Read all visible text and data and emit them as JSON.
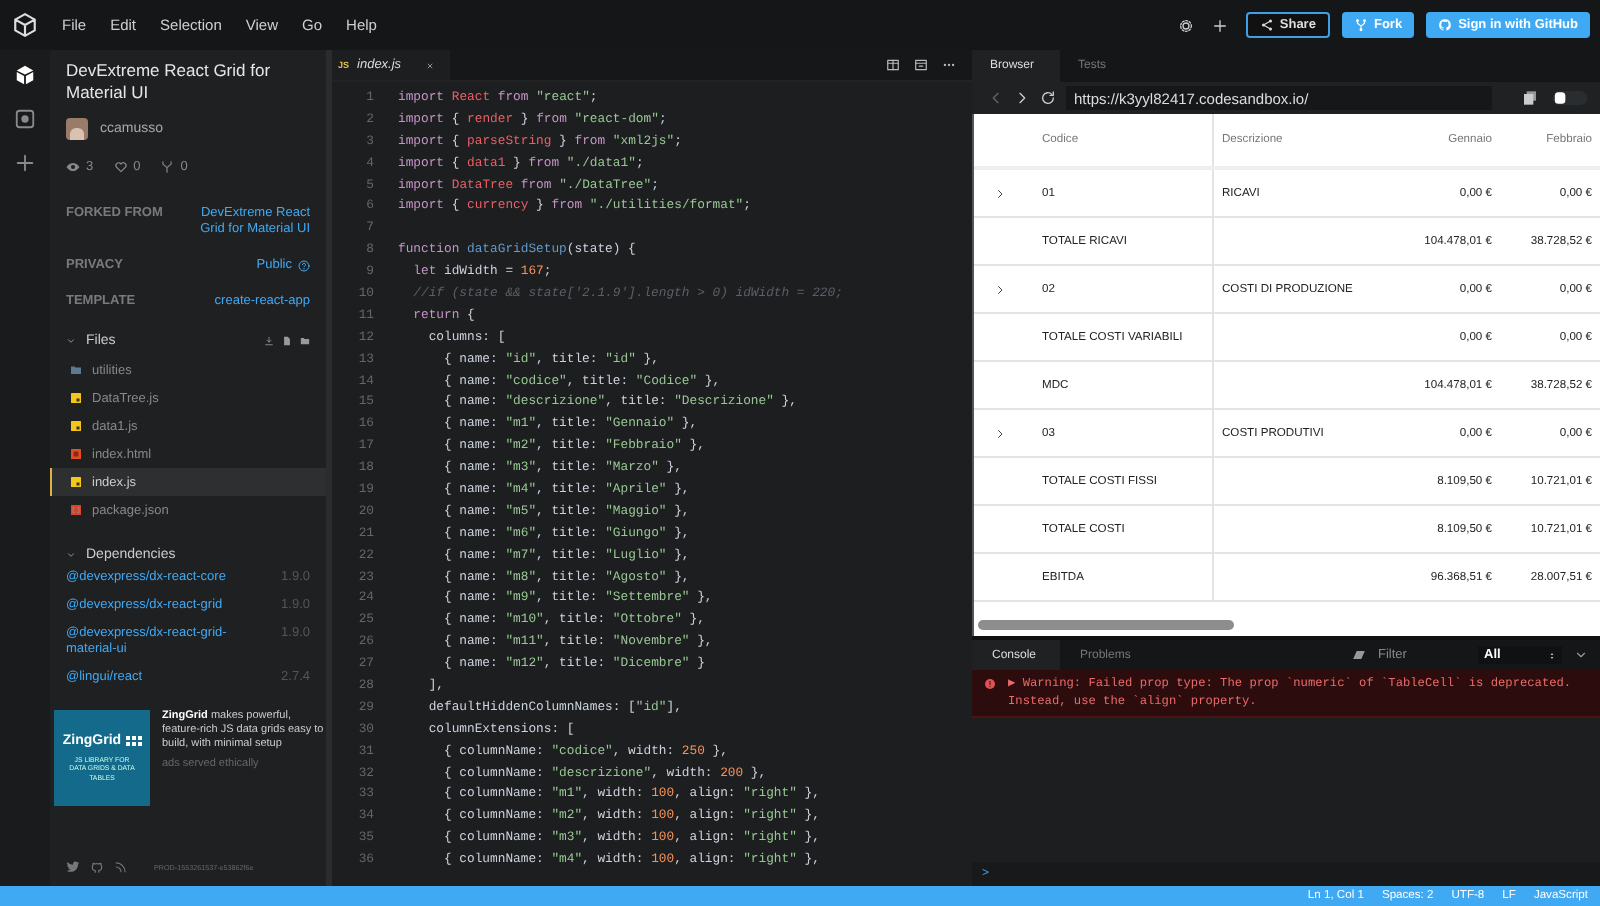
{
  "menu": [
    "File",
    "Edit",
    "Selection",
    "View",
    "Go",
    "Help"
  ],
  "header_actions": [
    {
      "kind": "settings"
    },
    {
      "kind": "add"
    }
  ],
  "header_buttons": [
    {
      "kind": "share",
      "label": "Share"
    },
    {
      "kind": "fork",
      "label": "Fork"
    },
    {
      "kind": "github",
      "label": "Sign in with GitHub"
    }
  ],
  "activity_bar": [
    {
      "kind": "sandbox",
      "selected": true
    },
    {
      "kind": "deploy",
      "selected": false
    },
    {
      "kind": "add",
      "selected": false
    }
  ],
  "sidebar": {
    "title": "DevExtreme React Grid for Material UI",
    "author": "ccamusso",
    "stats": [
      {
        "kind": "views",
        "value": "3"
      },
      {
        "kind": "likes",
        "value": "0"
      },
      {
        "kind": "forks",
        "value": "0"
      }
    ],
    "info": [
      {
        "label": "FORKED FROM",
        "value": "DevExtreme React Grid for Material UI",
        "kind": "link"
      },
      {
        "label": "PRIVACY",
        "value": "Public",
        "kind": "help"
      },
      {
        "label": "TEMPLATE",
        "value": "create-react-app",
        "kind": "link"
      }
    ],
    "files": {
      "title": "Files",
      "expanded": true,
      "items": [
        {
          "name": "utilities",
          "kind": "folder",
          "selected": false
        },
        {
          "name": "DataTree.js",
          "kind": "js",
          "selected": false
        },
        {
          "name": "data1.js",
          "kind": "js",
          "selected": false
        },
        {
          "name": "index.html",
          "kind": "html",
          "selected": false
        },
        {
          "name": "index.js",
          "kind": "js",
          "selected": true
        },
        {
          "name": "package.json",
          "kind": "json",
          "selected": false
        }
      ]
    },
    "dependencies": {
      "title": "Dependencies",
      "expanded": true,
      "items": [
        {
          "name": "@devexpress/dx-react-core",
          "version": "1.9.0"
        },
        {
          "name": "@devexpress/dx-react-grid",
          "version": "1.9.0"
        },
        {
          "name": "@devexpress/dx-react-grid-material-ui",
          "version": "1.9.0"
        },
        {
          "name": "@lingui/react",
          "version": "2.7.4"
        }
      ]
    },
    "ad": {
      "image_title": "ZingGrid",
      "image_caption": "JS LIBRARY FOR DATA GRIDS & DATA TABLES",
      "text": "**ZingGrid** makes powerful, feature-rich JS data grids easy to build, with minimal setup",
      "note": "ads served ethically"
    },
    "footer": {
      "build": "PROD-1553261537-e53862f6e"
    }
  },
  "editor": {
    "tabs": [
      {
        "badge": "JS",
        "label": "index.js",
        "selected": true
      }
    ],
    "lines": [
      {
        "n": "1",
        "tokens": [
          {
            "kind": "kw",
            "text": "import "
          },
          {
            "kind": "id",
            "text": "React "
          },
          {
            "kind": "kw",
            "text": "from "
          },
          {
            "kind": "str",
            "text": "\"react\""
          },
          {
            "kind": "p",
            "text": ";"
          }
        ]
      },
      {
        "n": "2",
        "tokens": [
          {
            "kind": "kw",
            "text": "import "
          },
          {
            "kind": "p",
            "text": "{ "
          },
          {
            "kind": "id",
            "text": "render"
          },
          {
            "kind": "p",
            "text": " } "
          },
          {
            "kind": "kw",
            "text": "from "
          },
          {
            "kind": "str",
            "text": "\"react-dom\""
          },
          {
            "kind": "p",
            "text": ";"
          }
        ]
      },
      {
        "n": "3",
        "tokens": [
          {
            "kind": "kw",
            "text": "import "
          },
          {
            "kind": "p",
            "text": "{ "
          },
          {
            "kind": "id",
            "text": "parseString"
          },
          {
            "kind": "p",
            "text": " } "
          },
          {
            "kind": "kw",
            "text": "from "
          },
          {
            "kind": "str",
            "text": "\"xml2js\""
          },
          {
            "kind": "p",
            "text": ";"
          }
        ]
      },
      {
        "n": "4",
        "tokens": [
          {
            "kind": "kw",
            "text": "import "
          },
          {
            "kind": "p",
            "text": "{ "
          },
          {
            "kind": "id",
            "text": "data1"
          },
          {
            "kind": "p",
            "text": " } "
          },
          {
            "kind": "kw",
            "text": "from "
          },
          {
            "kind": "str",
            "text": "\"./data1\""
          },
          {
            "kind": "p",
            "text": ";"
          }
        ]
      },
      {
        "n": "5",
        "tokens": [
          {
            "kind": "kw",
            "text": "import "
          },
          {
            "kind": "id",
            "text": "DataTree "
          },
          {
            "kind": "kw",
            "text": "from "
          },
          {
            "kind": "str",
            "text": "\"./DataTree\""
          },
          {
            "kind": "p",
            "text": ";"
          }
        ]
      },
      {
        "n": "6",
        "tokens": [
          {
            "kind": "kw",
            "text": "import "
          },
          {
            "kind": "p",
            "text": "{ "
          },
          {
            "kind": "id",
            "text": "currency"
          },
          {
            "kind": "p",
            "text": " } "
          },
          {
            "kind": "kw",
            "text": "from "
          },
          {
            "kind": "str",
            "text": "\"./utilities/format\""
          },
          {
            "kind": "p",
            "text": ";"
          }
        ]
      },
      {
        "n": "7"
      },
      {
        "n": "8",
        "tokens": [
          {
            "kind": "kw",
            "text": "function "
          },
          {
            "kind": "fn",
            "text": "dataGridSetup"
          },
          {
            "kind": "p",
            "text": "(state) {"
          }
        ]
      },
      {
        "n": "9",
        "tokens": [
          {
            "kind": "kw",
            "text": "  let "
          },
          {
            "kind": "p",
            "text": "idWidth = "
          },
          {
            "kind": "num",
            "text": "167"
          },
          {
            "kind": "p",
            "text": ";"
          }
        ]
      },
      {
        "n": "10",
        "tokens": [
          {
            "kind": "com",
            "text": "  //if (state && state['2.1.9'].length > 0) idWidth = 220;"
          }
        ]
      },
      {
        "n": "11",
        "tokens": [
          {
            "kind": "kw",
            "text": "  return"
          },
          {
            "kind": "p",
            "text": " {"
          }
        ]
      },
      {
        "n": "12",
        "tokens": [
          {
            "kind": "p",
            "text": "    columns: ["
          }
        ]
      },
      {
        "n": "13",
        "tokens": [
          {
            "kind": "p",
            "text": "      { name: "
          },
          {
            "kind": "str",
            "text": "\"id\""
          },
          {
            "kind": "p",
            "text": ", title: "
          },
          {
            "kind": "str",
            "text": "\"id\""
          },
          {
            "kind": "p",
            "text": " },"
          }
        ]
      },
      {
        "n": "14",
        "tokens": [
          {
            "kind": "p",
            "text": "      { name: "
          },
          {
            "kind": "str",
            "text": "\"codice\""
          },
          {
            "kind": "p",
            "text": ", title: "
          },
          {
            "kind": "str",
            "text": "\"Codice\""
          },
          {
            "kind": "p",
            "text": " },"
          }
        ]
      },
      {
        "n": "15",
        "tokens": [
          {
            "kind": "p",
            "text": "      { name: "
          },
          {
            "kind": "str",
            "text": "\"descrizione\""
          },
          {
            "kind": "p",
            "text": ", title: "
          },
          {
            "kind": "str",
            "text": "\"Descrizione\""
          },
          {
            "kind": "p",
            "text": " },"
          }
        ]
      },
      {
        "n": "16",
        "tokens": [
          {
            "kind": "p",
            "text": "      { name: "
          },
          {
            "kind": "str",
            "text": "\"m1\""
          },
          {
            "kind": "p",
            "text": ", title: "
          },
          {
            "kind": "str",
            "text": "\"Gennaio\""
          },
          {
            "kind": "p",
            "text": " },"
          }
        ]
      },
      {
        "n": "17",
        "tokens": [
          {
            "kind": "p",
            "text": "      { name: "
          },
          {
            "kind": "str",
            "text": "\"m2\""
          },
          {
            "kind": "p",
            "text": ", title: "
          },
          {
            "kind": "str",
            "text": "\"Febbraio\""
          },
          {
            "kind": "p",
            "text": " },"
          }
        ]
      },
      {
        "n": "18",
        "tokens": [
          {
            "kind": "p",
            "text": "      { name: "
          },
          {
            "kind": "str",
            "text": "\"m3\""
          },
          {
            "kind": "p",
            "text": ", title: "
          },
          {
            "kind": "str",
            "text": "\"Marzo\""
          },
          {
            "kind": "p",
            "text": " },"
          }
        ]
      },
      {
        "n": "19",
        "tokens": [
          {
            "kind": "p",
            "text": "      { name: "
          },
          {
            "kind": "str",
            "text": "\"m4\""
          },
          {
            "kind": "p",
            "text": ", title: "
          },
          {
            "kind": "str",
            "text": "\"Aprile\""
          },
          {
            "kind": "p",
            "text": " },"
          }
        ]
      },
      {
        "n": "20",
        "tokens": [
          {
            "kind": "p",
            "text": "      { name: "
          },
          {
            "kind": "str",
            "text": "\"m5\""
          },
          {
            "kind": "p",
            "text": ", title: "
          },
          {
            "kind": "str",
            "text": "\"Maggio\""
          },
          {
            "kind": "p",
            "text": " },"
          }
        ]
      },
      {
        "n": "21",
        "tokens": [
          {
            "kind": "p",
            "text": "      { name: "
          },
          {
            "kind": "str",
            "text": "\"m6\""
          },
          {
            "kind": "p",
            "text": ", title: "
          },
          {
            "kind": "str",
            "text": "\"Giungo\""
          },
          {
            "kind": "p",
            "text": " },"
          }
        ]
      },
      {
        "n": "22",
        "tokens": [
          {
            "kind": "p",
            "text": "      { name: "
          },
          {
            "kind": "str",
            "text": "\"m7\""
          },
          {
            "kind": "p",
            "text": ", title: "
          },
          {
            "kind": "str",
            "text": "\"Luglio\""
          },
          {
            "kind": "p",
            "text": " },"
          }
        ]
      },
      {
        "n": "23",
        "tokens": [
          {
            "kind": "p",
            "text": "      { name: "
          },
          {
            "kind": "str",
            "text": "\"m8\""
          },
          {
            "kind": "p",
            "text": ", title: "
          },
          {
            "kind": "str",
            "text": "\"Agosto\""
          },
          {
            "kind": "p",
            "text": " },"
          }
        ]
      },
      {
        "n": "24",
        "tokens": [
          {
            "kind": "p",
            "text": "      { name: "
          },
          {
            "kind": "str",
            "text": "\"m9\""
          },
          {
            "kind": "p",
            "text": ", title: "
          },
          {
            "kind": "str",
            "text": "\"Settembre\""
          },
          {
            "kind": "p",
            "text": " },"
          }
        ]
      },
      {
        "n": "25",
        "tokens": [
          {
            "kind": "p",
            "text": "      { name: "
          },
          {
            "kind": "str",
            "text": "\"m10\""
          },
          {
            "kind": "p",
            "text": ", title: "
          },
          {
            "kind": "str",
            "text": "\"Ottobre\""
          },
          {
            "kind": "p",
            "text": " },"
          }
        ]
      },
      {
        "n": "26",
        "tokens": [
          {
            "kind": "p",
            "text": "      { name: "
          },
          {
            "kind": "str",
            "text": "\"m11\""
          },
          {
            "kind": "p",
            "text": ", title: "
          },
          {
            "kind": "str",
            "text": "\"Novembre\""
          },
          {
            "kind": "p",
            "text": " },"
          }
        ]
      },
      {
        "n": "27",
        "tokens": [
          {
            "kind": "p",
            "text": "      { name: "
          },
          {
            "kind": "str",
            "text": "\"m12\""
          },
          {
            "kind": "p",
            "text": ", title: "
          },
          {
            "kind": "str",
            "text": "\"Dicembre\""
          },
          {
            "kind": "p",
            "text": " }"
          }
        ]
      },
      {
        "n": "28",
        "tokens": [
          {
            "kind": "p",
            "text": "    ],"
          }
        ]
      },
      {
        "n": "29",
        "tokens": [
          {
            "kind": "p",
            "text": "    defaultHiddenColumnNames: ["
          },
          {
            "kind": "str",
            "text": "\"id\""
          },
          {
            "kind": "p",
            "text": "],"
          }
        ]
      },
      {
        "n": "30",
        "tokens": [
          {
            "kind": "p",
            "text": "    columnExtensions: ["
          }
        ]
      },
      {
        "n": "31",
        "tokens": [
          {
            "kind": "p",
            "text": "      { columnName: "
          },
          {
            "kind": "str",
            "text": "\"codice\""
          },
          {
            "kind": "p",
            "text": ", width: "
          },
          {
            "kind": "num",
            "text": "250"
          },
          {
            "kind": "p",
            "text": " },"
          }
        ]
      },
      {
        "n": "32",
        "tokens": [
          {
            "kind": "p",
            "text": "      { columnName: "
          },
          {
            "kind": "str",
            "text": "\"descrizione\""
          },
          {
            "kind": "p",
            "text": ", width: "
          },
          {
            "kind": "num",
            "text": "200"
          },
          {
            "kind": "p",
            "text": " },"
          }
        ]
      },
      {
        "n": "33",
        "tokens": [
          {
            "kind": "p",
            "text": "      { columnName: "
          },
          {
            "kind": "str",
            "text": "\"m1\""
          },
          {
            "kind": "p",
            "text": ", width: "
          },
          {
            "kind": "num",
            "text": "100"
          },
          {
            "kind": "p",
            "text": ", align: "
          },
          {
            "kind": "str",
            "text": "\"right\""
          },
          {
            "kind": "p",
            "text": " },"
          }
        ]
      },
      {
        "n": "34",
        "tokens": [
          {
            "kind": "p",
            "text": "      { columnName: "
          },
          {
            "kind": "str",
            "text": "\"m2\""
          },
          {
            "kind": "p",
            "text": ", width: "
          },
          {
            "kind": "num",
            "text": "100"
          },
          {
            "kind": "p",
            "text": ", align: "
          },
          {
            "kind": "str",
            "text": "\"right\""
          },
          {
            "kind": "p",
            "text": " },"
          }
        ]
      },
      {
        "n": "35",
        "tokens": [
          {
            "kind": "p",
            "text": "      { columnName: "
          },
          {
            "kind": "str",
            "text": "\"m3\""
          },
          {
            "kind": "p",
            "text": ", width: "
          },
          {
            "kind": "num",
            "text": "100"
          },
          {
            "kind": "p",
            "text": ", align: "
          },
          {
            "kind": "str",
            "text": "\"right\""
          },
          {
            "kind": "p",
            "text": " },"
          }
        ]
      },
      {
        "n": "36",
        "tokens": [
          {
            "kind": "p",
            "text": "      { columnName: "
          },
          {
            "kind": "str",
            "text": "\"m4\""
          },
          {
            "kind": "p",
            "text": ", width: "
          },
          {
            "kind": "num",
            "text": "100"
          },
          {
            "kind": "p",
            "text": ", align: "
          },
          {
            "kind": "str",
            "text": "\"right\""
          },
          {
            "kind": "p",
            "text": " },"
          }
        ]
      }
    ]
  },
  "preview": {
    "tabs": [
      {
        "label": "Browser",
        "selected": true
      },
      {
        "label": "Tests",
        "selected": false
      }
    ],
    "url": "https://k3yyl82417.codesandbox.io/",
    "table": {
      "columns": [
        "Codice",
        "Descrizione",
        "Gennaio",
        "Febbraio"
      ],
      "rows": [
        {
          "expandable": true,
          "cells": [
            "01",
            "RICAVI",
            "0,00 €",
            "0,00 €"
          ]
        },
        {
          "expandable": false,
          "cells": [
            "TOTALE RICAVI",
            "",
            "104.478,01 €",
            "38.728,52 €"
          ]
        },
        {
          "expandable": true,
          "cells": [
            "02",
            "COSTI DI PRODUZIONE",
            "0,00 €",
            "0,00 €"
          ]
        },
        {
          "expandable": false,
          "cells": [
            "TOTALE COSTI VARIABILI",
            "",
            "0,00 €",
            "0,00 €"
          ]
        },
        {
          "expandable": false,
          "cells": [
            "MDC",
            "",
            "104.478,01 €",
            "38.728,52 €"
          ]
        },
        {
          "expandable": true,
          "cells": [
            "03",
            "COSTI PRODUTIVI",
            "0,00 €",
            "0,00 €"
          ]
        },
        {
          "expandable": false,
          "cells": [
            "TOTALE COSTI FISSI",
            "",
            "8.109,50 €",
            "10.721,01 €"
          ]
        },
        {
          "expandable": false,
          "cells": [
            "TOTALE COSTI",
            "",
            "8.109,50 €",
            "10.721,01 €"
          ]
        },
        {
          "expandable": false,
          "cells": [
            "EBITDA",
            "",
            "96.368,51 €",
            "28.007,51 €"
          ]
        }
      ]
    }
  },
  "console": {
    "tabs": [
      {
        "label": "Console",
        "selected": true
      },
      {
        "label": "Problems",
        "selected": false
      }
    ],
    "filter": {
      "placeholder": "Filter"
    },
    "level": "All",
    "messages": [
      {
        "kind": "error",
        "text": "▶ Warning: Failed prop type: The prop `numeric` of `TableCell` is deprecated. Instead, use the `align` property."
      }
    ],
    "prompt": ">"
  },
  "status_bar": [
    "Ln 1, Col 1",
    "Spaces: 2",
    "UTF-8",
    "LF",
    "JavaScript"
  ]
}
